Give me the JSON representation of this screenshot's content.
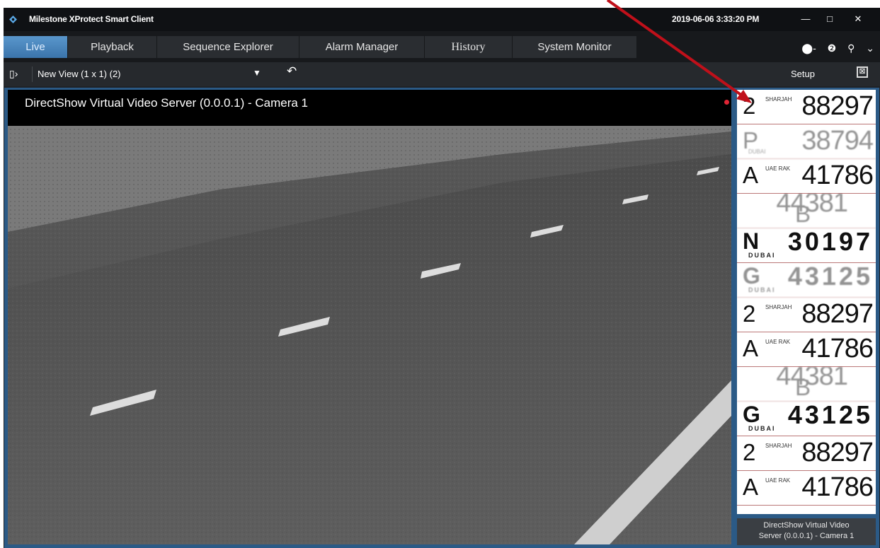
{
  "app": {
    "title": "Milestone XProtect Smart Client",
    "datetime": "2019-06-06 3:33:20 PM"
  },
  "window_buttons": {
    "minimize": "—",
    "maximize": "□",
    "close": "✕"
  },
  "tabs": [
    {
      "label": "Live",
      "active": true
    },
    {
      "label": "Playback",
      "active": false
    },
    {
      "label": "Sequence Explorer",
      "active": false
    },
    {
      "label": "Alarm Manager",
      "active": false
    },
    {
      "label": "History",
      "active": false
    },
    {
      "label": "System Monitor",
      "active": false
    }
  ],
  "tab_icons": [
    "connection-icon",
    "help-icon",
    "pin-icon",
    "chevron-down-icon"
  ],
  "toolbar": {
    "view_selector": "New View (1 x 1) (2)",
    "setup_label": "Setup"
  },
  "camera": {
    "title": "DirectShow Virtual Video Server (0.0.0.1) - Camera 1",
    "caption_line1": "DirectShow Virtual Video",
    "caption_line2": "Server (0.0.0.1) - Camera 1"
  },
  "plates": [
    {
      "letter": "2",
      "number": "88297",
      "emirate": "SHARJAH",
      "style": "sharjah"
    },
    {
      "letter": "P",
      "number": "38794",
      "emirate": "DUBAI",
      "style": "faint"
    },
    {
      "letter": "A",
      "number": "41786",
      "emirate": "UAE RAK",
      "style": "rak"
    },
    {
      "letter": "B",
      "number": "44381",
      "emirate": "",
      "style": "faint"
    },
    {
      "letter": "N",
      "number": "30197",
      "emirate": "DUBAI",
      "style": "dubai"
    },
    {
      "letter": "G",
      "number": "43125",
      "emirate": "DUBAI",
      "style": "faint"
    },
    {
      "letter": "2",
      "number": "88297",
      "emirate": "SHARJAH",
      "style": "sharjah"
    },
    {
      "letter": "A",
      "number": "41786",
      "emirate": "UAE RAK",
      "style": "rak"
    },
    {
      "letter": "B",
      "number": "44381",
      "emirate": "",
      "style": "faint"
    },
    {
      "letter": "G",
      "number": "43125",
      "emirate": "DUBAI",
      "style": "dubai"
    },
    {
      "letter": "2",
      "number": "88297",
      "emirate": "SHARJAH",
      "style": "sharjah"
    },
    {
      "letter": "A",
      "number": "41786",
      "emirate": "UAE RAK",
      "style": "rak"
    }
  ],
  "colors": {
    "active_tab": "#3b74ab",
    "rec_dot": "#e02535",
    "annotation_arrow": "#c0101a"
  }
}
